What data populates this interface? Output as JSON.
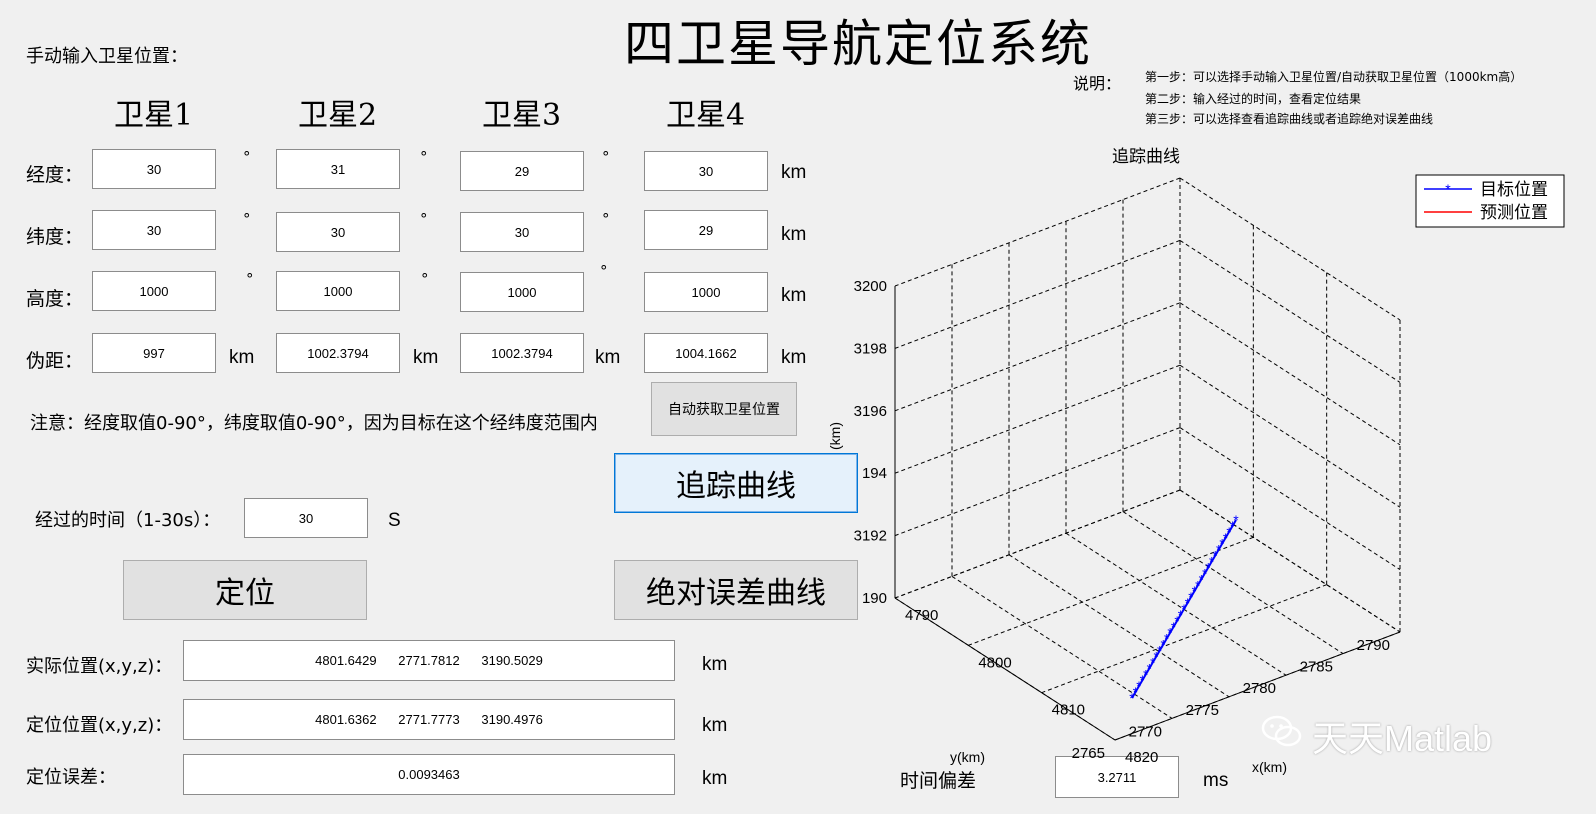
{
  "title": "四卫星导航定位系统",
  "manual_input_label": "手动输入卫星位置：",
  "satellites": [
    {
      "name": "卫星1",
      "lon": "30",
      "lat": "30",
      "alt": "1000",
      "pseudo": "997"
    },
    {
      "name": "卫星2",
      "lon": "31",
      "lat": "30",
      "alt": "1000",
      "pseudo": "1002.3794"
    },
    {
      "name": "卫星3",
      "lon": "29",
      "lat": "30",
      "alt": "1000",
      "pseudo": "1002.3794"
    },
    {
      "name": "卫星4",
      "lon": "30",
      "lat": "29",
      "alt": "1000",
      "pseudo": "1004.1662"
    }
  ],
  "row_labels": {
    "lon": "经度：",
    "lat": "纬度：",
    "alt": "高度：",
    "pseudo": "伪距："
  },
  "degree_symbol": "°",
  "km": "km",
  "note_text": "注意：经度取值0-90°，纬度取值0-90°，因为目标在这个经纬度范围内",
  "auto_button": "自动获取卫星位置",
  "time_label": "经过的时间（1-30s）：",
  "time_value": "30",
  "time_unit": "S",
  "locate_button": "定位",
  "track_button": "追踪曲线",
  "abs_error_button": "绝对误差曲线",
  "actual_label": "实际位置(x,y,z)：",
  "actual_value": "4801.6429      2771.7812      3190.5029",
  "located_label": "定位位置(x,y,z)：",
  "located_value": "4801.6362      2771.7773      3190.4976",
  "error_label": "定位误差：",
  "error_value": "0.0093463",
  "time_bias_label": "时间偏差",
  "time_bias_value": "3.2711",
  "time_bias_unit": "ms",
  "instructions": {
    "label": "说明：",
    "steps": [
      "第一步：可以选择手动输入卫星位置/自动获取卫星位置（1000km高）",
      "第二步：输入经过的时间，查看定位结果",
      "第三步：可以选择查看追踪曲线或者追踪绝对误差曲线"
    ]
  },
  "watermark": "天天Matlab",
  "chart_data": {
    "type": "line3d",
    "title": "追踪曲线",
    "legend": [
      "目标位置",
      "预测位置"
    ],
    "legend_placement": "top-right",
    "xlabel": "x(km)",
    "ylabel": "y(km)",
    "zlabel": "(km)",
    "x_ticks": [
      "4790",
      "4800",
      "4810",
      "4820"
    ],
    "y_ticks": [
      "2765",
      "2770",
      "2775",
      "2780",
      "2785",
      "2790"
    ],
    "z_ticks": [
      "190",
      "3192",
      "194",
      "3196",
      "3198",
      "3200"
    ],
    "grid": true,
    "colors": {
      "target": "#0000ff",
      "predicted": "#ff0000"
    }
  }
}
